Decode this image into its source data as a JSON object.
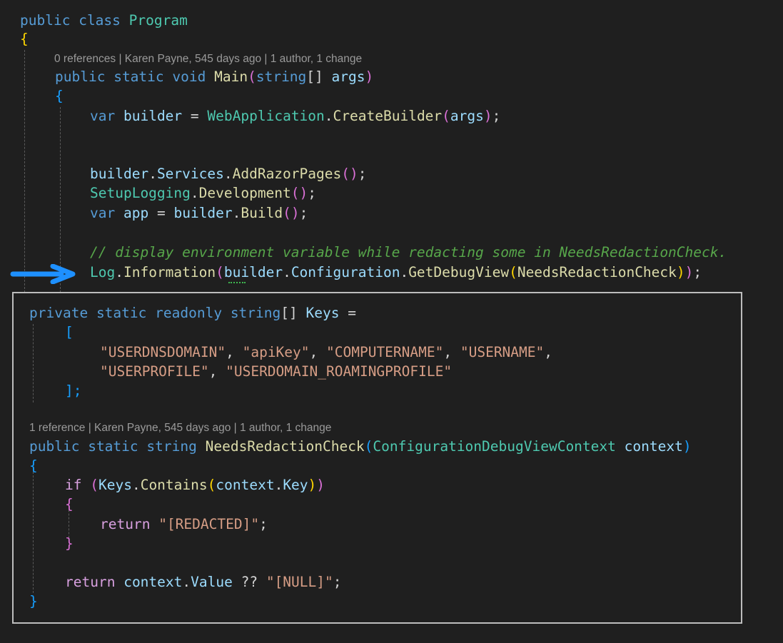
{
  "editor": {
    "class_decl": {
      "public": "public",
      "class": "class",
      "name": "Program"
    },
    "open_brace": "{",
    "codelens_main": "0 references | Karen Payne, 545 days ago | 1 author, 1 change",
    "main_signature": {
      "public": "public",
      "static": "static",
      "void": "void",
      "name": "Main",
      "param_type": "string",
      "brackets": "[]",
      "param_name": "args"
    },
    "main_open": "{",
    "line_builder": {
      "var": "var",
      "name": "builder",
      "eq": "=",
      "cls": "WebApplication",
      "method": "CreateBuilder",
      "arg": "args"
    },
    "line_services": {
      "obj": "builder",
      "prop": "Services",
      "method": "AddRazorPages"
    },
    "line_logging": {
      "cls": "SetupLogging",
      "method": "Development"
    },
    "line_app": {
      "var": "var",
      "name": "app",
      "eq": "=",
      "obj": "builder",
      "method": "Build"
    },
    "comment": "// display environment variable while redacting some in NeedsRedactionCheck.",
    "line_log": {
      "cls": "Log",
      "method": "Information",
      "obj": "builder",
      "prop": "Configuration",
      "method2": "GetDebugView",
      "arg": "NeedsRedactionCheck"
    }
  },
  "arrow": {
    "icon": "arrow-right-icon",
    "color": "#1e90ff"
  },
  "panel": {
    "keys_decl": {
      "private": "private",
      "static": "static",
      "readonly": "readonly",
      "type": "string",
      "brackets": "[]",
      "name": "Keys",
      "eq": "="
    },
    "open_bracket": "[",
    "keys_line1": [
      "\"USERDNSDOMAIN\"",
      "\"apiKey\"",
      "\"COMPUTERNAME\"",
      "\"USERNAME\""
    ],
    "keys_line2": [
      "\"USERPROFILE\"",
      "\"USERDOMAIN_ROAMINGPROFILE\""
    ],
    "close_bracket": "];",
    "codelens_check": "1 reference | Karen Payne, 545 days ago | 1 author, 1 change",
    "check_signature": {
      "public": "public",
      "static": "static",
      "type": "string",
      "name": "NeedsRedactionCheck",
      "param_type": "ConfigurationDebugViewContext",
      "param_name": "context"
    },
    "open_brace": "{",
    "if_line": {
      "if": "if",
      "obj": "Keys",
      "method": "Contains",
      "arg_obj": "context",
      "arg_prop": "Key"
    },
    "if_open": "{",
    "return_redacted": {
      "return": "return",
      "value": "\"[REDACTED]\""
    },
    "if_close": "}",
    "return_value": {
      "return": "return",
      "obj": "context",
      "prop": "Value",
      "op": "??",
      "value": "\"[NULL]\""
    },
    "close_brace": "}"
  },
  "colors": {
    "background": "#1f1f1f",
    "keyword": "#569cd6",
    "control_keyword": "#d8a0df",
    "type": "#4ec9b0",
    "method": "#dcdcaa",
    "variable": "#9cdcfe",
    "string": "#d69d85",
    "comment": "#57a64a",
    "panel_border": "#bdbdbd"
  }
}
